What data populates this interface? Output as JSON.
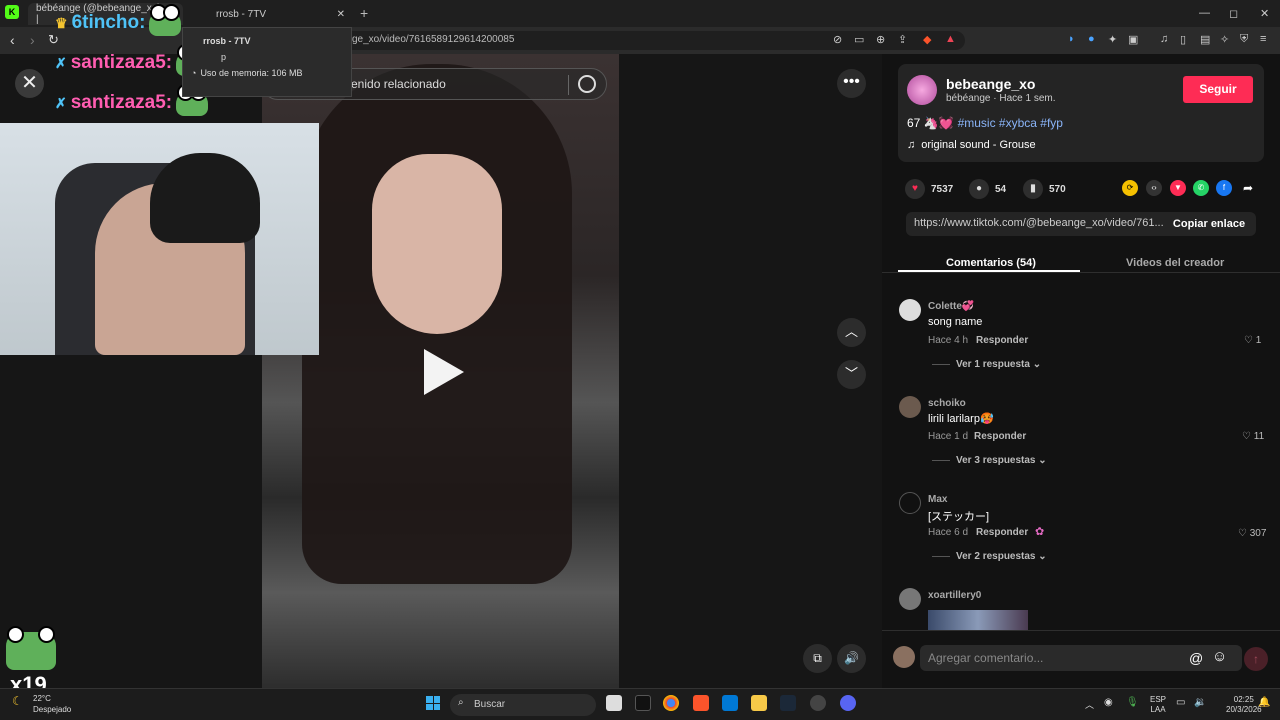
{
  "browser": {
    "tabs": [
      {
        "label": "bébéange (@bebeange_xo) |",
        "close": "✕"
      },
      {
        "label": "rrosb - 7TV",
        "close": "✕"
      }
    ],
    "new_tab": "+",
    "address": "ge_xo/video/7616589129614200085",
    "window_controls": {
      "minimize": "—",
      "maximize": "◻",
      "close": "✕"
    }
  },
  "tab_popup": {
    "title": "rrosb - 7TV",
    "subtitle": "p",
    "memory": "Uso de memoria: 106 MB"
  },
  "overlay": {
    "chat": [
      {
        "user": "6tincho:",
        "badge": "crown"
      },
      {
        "user": "santizaza5:",
        "badge": "sword"
      },
      {
        "user": "santizaza5:",
        "badge": "sword"
      }
    ],
    "counter": "x19"
  },
  "video": {
    "search_placeholder": "enido relacionado",
    "close_icon": "close-icon",
    "more": "•••"
  },
  "creator": {
    "username": "bebeange_xo",
    "display": "bébéange · Hace 1 sem.",
    "follow_label": "Seguir",
    "caption_prefix": "67 🦄💓",
    "hashtags": "#music #xybca #fyp",
    "sound": "original sound - Grouse"
  },
  "stats": {
    "likes": "7537",
    "comments": "54",
    "saves": "570"
  },
  "link": {
    "url": "https://www.tiktok.com/@bebeange_xo/video/761...",
    "copy_label": "Copiar enlace"
  },
  "tabs": {
    "comments": "Comentarios (54)",
    "creator_videos": "Videos del creador"
  },
  "comments": [
    {
      "name": "Colette💞",
      "text": "song name",
      "time": "Hace 4 h",
      "reply": "Responder",
      "likes": "1",
      "view_replies": "Ver 1 respuesta"
    },
    {
      "name": "schoiko",
      "text": "lirili larilarp🥵",
      "time": "Hace 1 d",
      "reply": "Responder",
      "likes": "11",
      "view_replies": "Ver 3 respuestas"
    },
    {
      "name": "Max",
      "text": "[ステッカー]",
      "time": "Hace 6 d",
      "reply": "Responder",
      "likes": "307",
      "view_replies": "Ver 2 respuestas"
    },
    {
      "name": "xoartillery0",
      "text": "",
      "time": "",
      "reply": "",
      "likes": "",
      "view_replies": ""
    }
  ],
  "comment_input": {
    "placeholder": "Agregar comentario...",
    "mention": "@",
    "emoji": "☺"
  },
  "taskbar": {
    "weather_temp": "22°C",
    "weather_desc": "Despejado",
    "search_label": "Buscar",
    "lang_top": "ESP",
    "lang_bottom": "LAA",
    "time": "02:25",
    "date": "20/3/2026"
  },
  "colors": {
    "accent": "#fe2c55",
    "panel_bg": "#121212",
    "hashtag": "#8ab4f8"
  }
}
